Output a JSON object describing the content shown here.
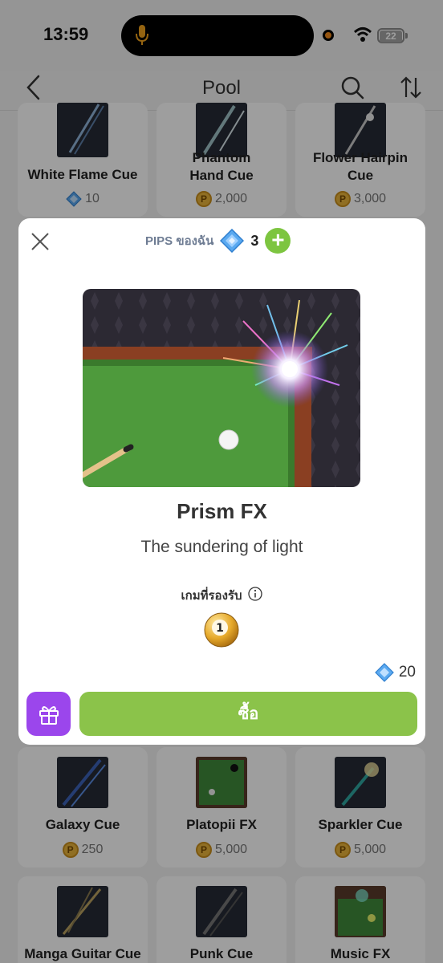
{
  "status": {
    "time": "13:59",
    "battery": "22"
  },
  "nav": {
    "title": "Pool"
  },
  "grid": {
    "row1": [
      {
        "name": "White Flame Cue",
        "price": "10",
        "currency": "pips"
      },
      {
        "name": "Phantom Hand Cue",
        "price": "2,000",
        "currency": "coin"
      },
      {
        "name": "Flower Hairpin Cue",
        "price": "3,000",
        "currency": "coin"
      }
    ],
    "row3": [
      {
        "name": "Galaxy Cue",
        "price": "250",
        "currency": "coin"
      },
      {
        "name": "Platopii FX",
        "price": "5,000",
        "currency": "coin"
      },
      {
        "name": "Sparkler Cue",
        "price": "5,000",
        "currency": "coin"
      }
    ],
    "row4": [
      {
        "name": "Manga Guitar Cue"
      },
      {
        "name": "Punk Cue"
      },
      {
        "name": "Music FX"
      }
    ]
  },
  "modal": {
    "pips_label": "PIPS ของฉัน",
    "pips_count": "3",
    "add_label": "+",
    "item_title": "Prism FX",
    "item_desc": "The sundering of light",
    "supported_label": "เกมที่รองรับ",
    "ball_number": "1",
    "cost": "20",
    "buy_label": "ซื้อ"
  },
  "colors": {
    "accent_green": "#8bc34a",
    "gift_purple": "#9b46ec",
    "pips_blue": "#5aa9f0",
    "coin_gold": "#e9b43a"
  },
  "icons": [
    "mic-icon",
    "wifi-icon",
    "back-arrow-icon",
    "search-icon",
    "sort-icon",
    "close-icon",
    "gem-icon",
    "gift-icon",
    "info-icon",
    "billiard-ball-icon",
    "coin-icon"
  ]
}
